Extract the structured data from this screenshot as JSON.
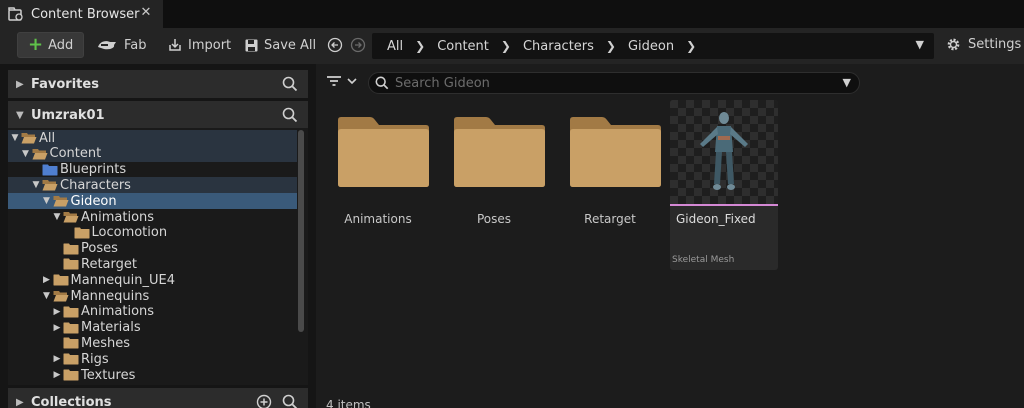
{
  "tab": {
    "title": "Content Browser",
    "close": "✕"
  },
  "toolbar": {
    "add_label": "Add",
    "fab_label": "Fab",
    "import_label": "Import",
    "saveall_label": "Save All",
    "settings_label": "Settings"
  },
  "breadcrumb": [
    "All",
    "Content",
    "Characters",
    "Gideon"
  ],
  "sidebar": {
    "favorites_title": "Favorites",
    "project_title": "Umzrak01",
    "collections_title": "Collections",
    "tree": [
      {
        "label": "All",
        "depth": 0,
        "arrow": "▼",
        "state": "sel-light",
        "icon": "folder-open"
      },
      {
        "label": "Content",
        "depth": 1,
        "arrow": "▼",
        "state": "sel-light",
        "icon": "folder-open"
      },
      {
        "label": "Blueprints",
        "depth": 2,
        "arrow": "",
        "state": "",
        "icon": "folder-blue"
      },
      {
        "label": "Characters",
        "depth": 2,
        "arrow": "▼",
        "state": "sel-light",
        "icon": "folder-open"
      },
      {
        "label": "Gideon",
        "depth": 3,
        "arrow": "▼",
        "state": "sel",
        "icon": "folder-open"
      },
      {
        "label": "Animations",
        "depth": 4,
        "arrow": "▼",
        "state": "",
        "icon": "folder-open"
      },
      {
        "label": "Locomotion",
        "depth": 5,
        "arrow": "",
        "state": "",
        "icon": "folder"
      },
      {
        "label": "Poses",
        "depth": 4,
        "arrow": "",
        "state": "",
        "icon": "folder"
      },
      {
        "label": "Retarget",
        "depth": 4,
        "arrow": "",
        "state": "",
        "icon": "folder"
      },
      {
        "label": "Mannequin_UE4",
        "depth": 3,
        "arrow": "▶",
        "state": "",
        "icon": "folder"
      },
      {
        "label": "Mannequins",
        "depth": 3,
        "arrow": "▼",
        "state": "",
        "icon": "folder-open"
      },
      {
        "label": "Animations",
        "depth": 4,
        "arrow": "▶",
        "state": "",
        "icon": "folder"
      },
      {
        "label": "Materials",
        "depth": 4,
        "arrow": "▶",
        "state": "",
        "icon": "folder"
      },
      {
        "label": "Meshes",
        "depth": 4,
        "arrow": "",
        "state": "",
        "icon": "folder"
      },
      {
        "label": "Rigs",
        "depth": 4,
        "arrow": "▶",
        "state": "",
        "icon": "folder"
      },
      {
        "label": "Textures",
        "depth": 4,
        "arrow": "▶",
        "state": "",
        "icon": "folder"
      }
    ]
  },
  "search": {
    "placeholder": "Search Gideon"
  },
  "folders": [
    "Animations",
    "Poses",
    "Retarget"
  ],
  "asset": {
    "name": "Gideon_Fixed",
    "type": "Skeletal Mesh"
  },
  "status": {
    "items": "4 items"
  },
  "colors": {
    "folder": "#c9a066",
    "selection": "#3a5a7a",
    "accent_green": "#5fc24a",
    "asset_line": "#d488d4"
  }
}
